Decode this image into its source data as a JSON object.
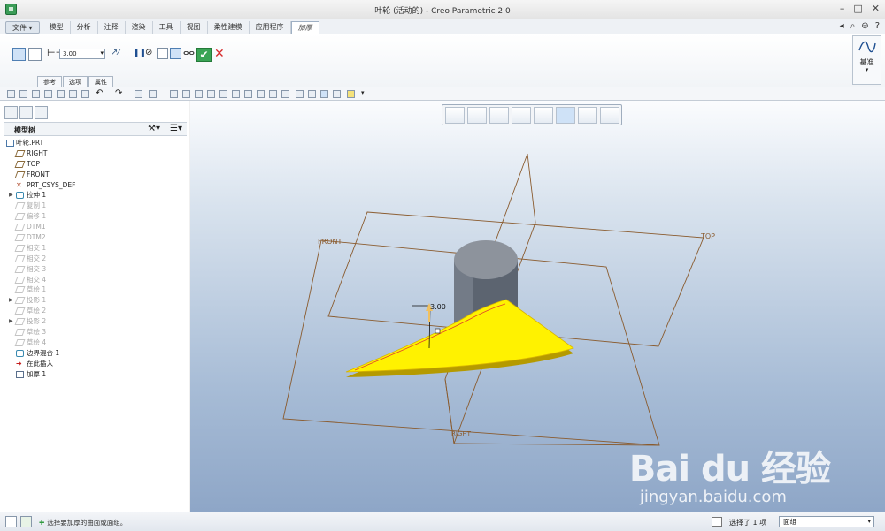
{
  "window": {
    "title": "叶轮 (活动的) - Creo Parametric 2.0"
  },
  "menu": {
    "file": "文件",
    "tabs": [
      "模型",
      "分析",
      "注释",
      "渲染",
      "工具",
      "视图",
      "柔性建模",
      "应用程序"
    ],
    "active_tab": "加厚"
  },
  "ribbon": {
    "thickness_value": "3.00",
    "subtabs": [
      "参考",
      "选项",
      "属性"
    ],
    "base_label": "基准"
  },
  "model_tree": {
    "title": "模型树",
    "items": [
      {
        "label": "叶轮.PRT"
      },
      {
        "label": "RIGHT"
      },
      {
        "label": "TOP"
      },
      {
        "label": "FRONT"
      },
      {
        "label": "PRT_CSYS_DEF"
      },
      {
        "label": "拉伸 1"
      },
      {
        "label": "复制 1"
      },
      {
        "label": "偏移 1"
      },
      {
        "label": "DTM1"
      },
      {
        "label": "DTM2"
      },
      {
        "label": "相交 1"
      },
      {
        "label": "相交 2"
      },
      {
        "label": "相交 3"
      },
      {
        "label": "相交 4"
      },
      {
        "label": "草绘 1"
      },
      {
        "label": "投影 1"
      },
      {
        "label": "草绘 2"
      },
      {
        "label": "投影 2"
      },
      {
        "label": "草绘 3"
      },
      {
        "label": "草绘 4"
      },
      {
        "label": "边界混合 1"
      },
      {
        "label": "在此插入"
      },
      {
        "label": "加厚 1"
      }
    ]
  },
  "viewport": {
    "datum_labels": {
      "front": "FRONT",
      "top": "TOP",
      "right": "RIGHT"
    },
    "dimension_value": "3.00"
  },
  "watermark": {
    "brand": "Bai du 经验",
    "url": "jingyan.baidu.com"
  },
  "status": {
    "message": "选择要加厚的曲面或面组。",
    "selection_count": "选择了 1 项",
    "filter": "面组"
  }
}
